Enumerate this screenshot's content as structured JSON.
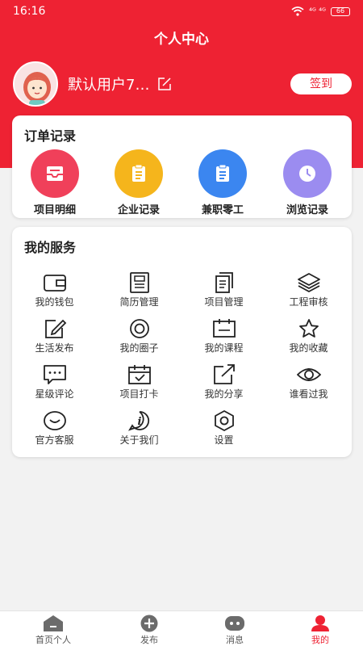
{
  "status": {
    "time": "16:16",
    "signal": "⁴ᴳ ⁴ᴳ",
    "battery": "66"
  },
  "header": {
    "title": "个人中心"
  },
  "profile": {
    "username": "默认用户7…",
    "signin_label": "签到"
  },
  "orders": {
    "title": "订单记录",
    "items": [
      {
        "label": "项目明细",
        "icon": "inbox-icon",
        "color": "#f0405a"
      },
      {
        "label": "企业记录",
        "icon": "clipboard-icon",
        "color": "#f5b51c"
      },
      {
        "label": "兼职零工",
        "icon": "clipboard-icon",
        "color": "#3b86f0"
      },
      {
        "label": "浏览记录",
        "icon": "clock-icon",
        "color": "#9b8cf0"
      }
    ]
  },
  "services": {
    "title": "我的服务",
    "items": [
      {
        "label": "我的钱包",
        "icon": "wallet-icon"
      },
      {
        "label": "简历管理",
        "icon": "resume-icon"
      },
      {
        "label": "项目管理",
        "icon": "documents-icon"
      },
      {
        "label": "工程审核",
        "icon": "layers-icon"
      },
      {
        "label": "生活发布",
        "icon": "edit-icon"
      },
      {
        "label": "我的圈子",
        "icon": "circle-icon"
      },
      {
        "label": "我的课程",
        "icon": "calendar-icon"
      },
      {
        "label": "我的收藏",
        "icon": "star-icon"
      },
      {
        "label": "星级评论",
        "icon": "comment-icon"
      },
      {
        "label": "项目打卡",
        "icon": "calendar-check-icon"
      },
      {
        "label": "我的分享",
        "icon": "share-icon"
      },
      {
        "label": "谁看过我",
        "icon": "eye-icon"
      },
      {
        "label": "官方客服",
        "icon": "smile-icon"
      },
      {
        "label": "关于我们",
        "icon": "info-icon"
      },
      {
        "label": "设置",
        "icon": "settings-icon"
      }
    ]
  },
  "tabbar": {
    "items": [
      {
        "label": "首页个人",
        "icon": "home-icon"
      },
      {
        "label": "发布",
        "icon": "plus-icon"
      },
      {
        "label": "消息",
        "icon": "message-icon"
      },
      {
        "label": "我的",
        "icon": "user-icon",
        "active": true
      }
    ]
  },
  "colors": {
    "accent": "#ee2233",
    "background": "#f2f2f2"
  }
}
